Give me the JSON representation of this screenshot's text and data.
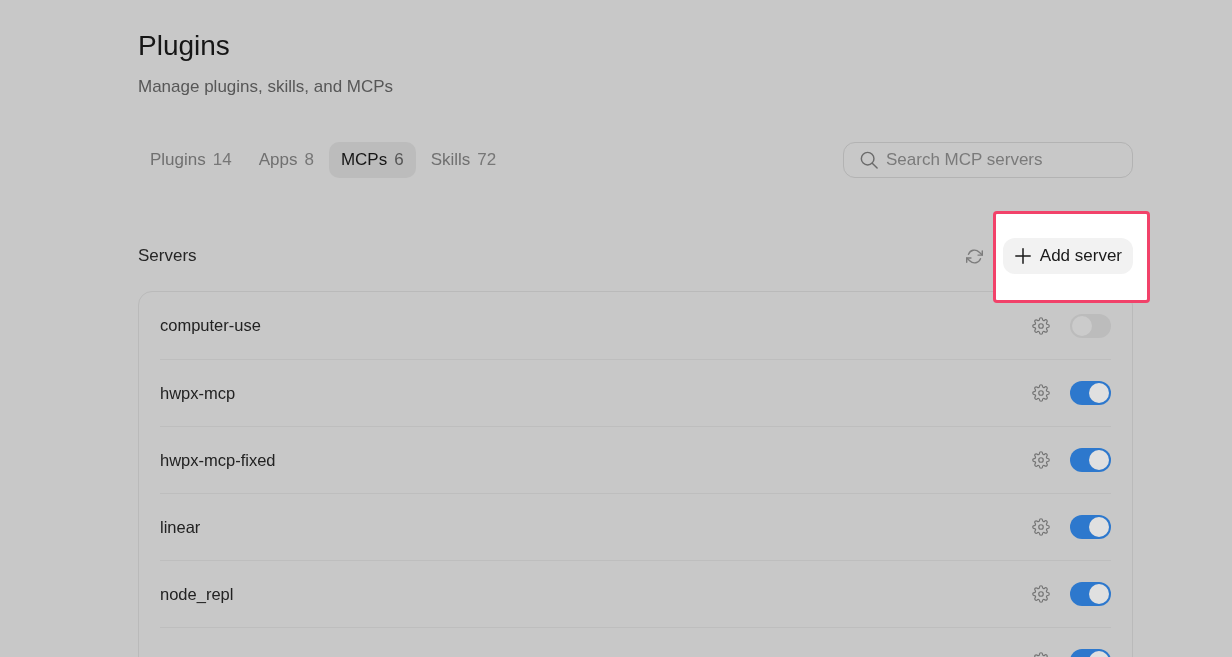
{
  "page": {
    "title": "Plugins",
    "subtitle": "Manage plugins, skills, and MCPs"
  },
  "tabs": [
    {
      "label": "Plugins",
      "count": "14",
      "selected": false
    },
    {
      "label": "Apps",
      "count": "8",
      "selected": false
    },
    {
      "label": "MCPs",
      "count": "6",
      "selected": true
    },
    {
      "label": "Skills",
      "count": "72",
      "selected": false
    }
  ],
  "search": {
    "placeholder": "Search MCP servers"
  },
  "servers_section": {
    "title": "Servers",
    "add_button": {
      "label": "Add server",
      "highlighted": true
    }
  },
  "servers": [
    {
      "name": "computer-use",
      "on": false
    },
    {
      "name": "hwpx-mcp",
      "on": true
    },
    {
      "name": "hwpx-mcp-fixed",
      "on": true
    },
    {
      "name": "linear",
      "on": true
    },
    {
      "name": "node_repl",
      "on": true
    },
    {
      "on": true
    }
  ]
}
